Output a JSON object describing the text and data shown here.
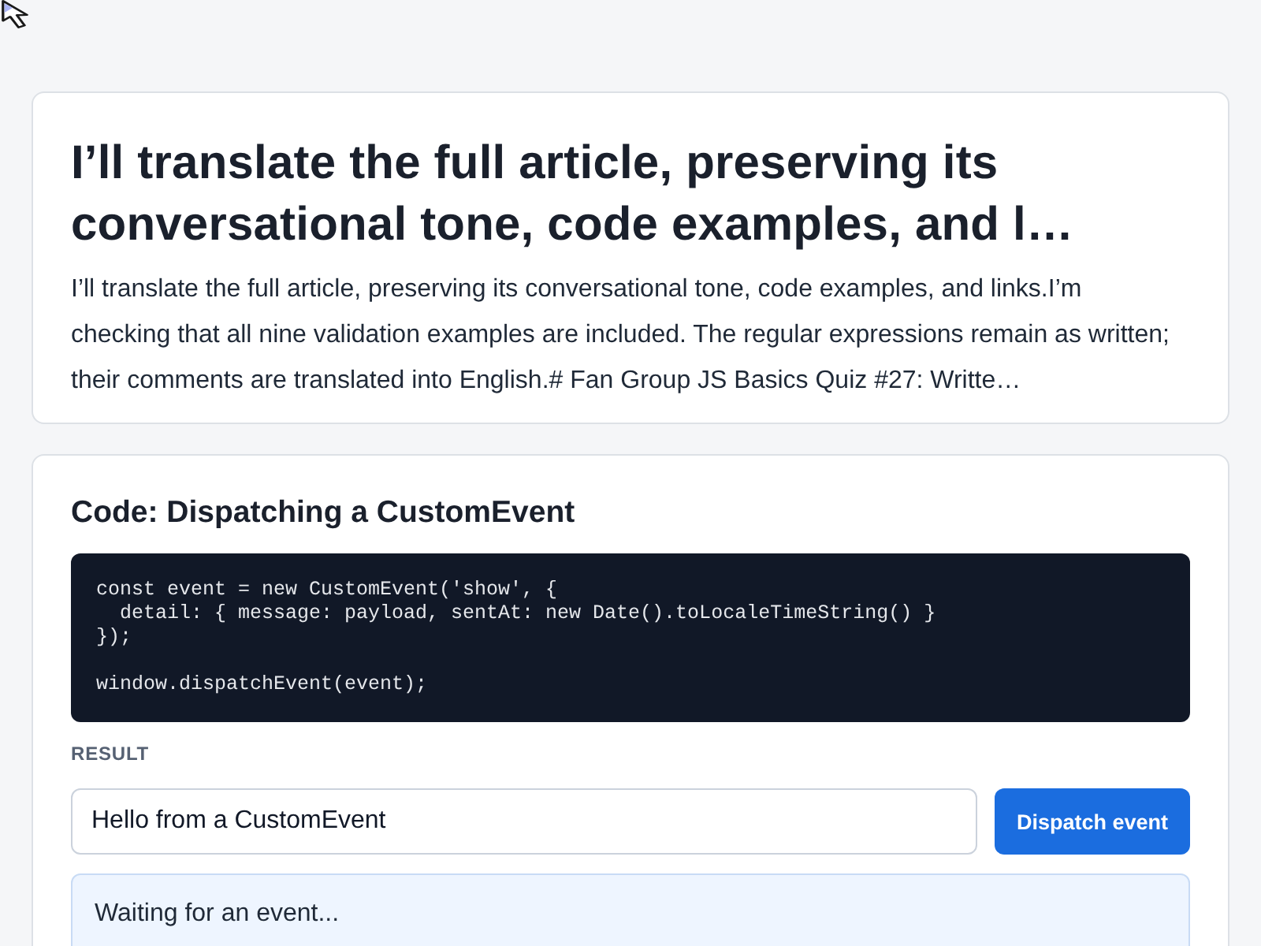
{
  "summary_card": {
    "title": "I’ll translate the full article, preserving its conversational tone, code examples, and l…",
    "summary": "I’ll translate the full article, preserving its conversational tone, code examples, and links.I’m checking that all nine validation examples are included. The regular expressions remain as written; their comments are translated into English.# Fan Group JS Basics Quiz #27: Writte…"
  },
  "code_card": {
    "heading": "Code: Dispatching a CustomEvent",
    "code": "const event = new CustomEvent('show', {\n  detail: { message: payload, sentAt: new Date().toLocaleTimeString() }\n});\n\nwindow.dispatchEvent(event);",
    "result_label": "RESULT",
    "input": {
      "value": "Hello from a CustomEvent"
    },
    "button": "Dispatch event",
    "output": "Waiting for an event..."
  }
}
